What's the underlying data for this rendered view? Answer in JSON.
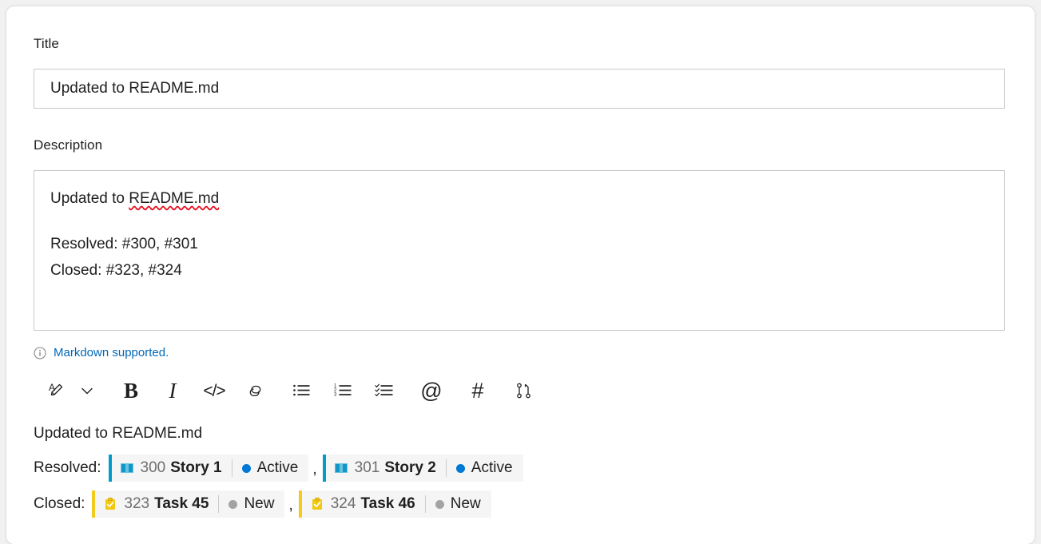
{
  "form": {
    "title_label": "Title",
    "title_value": "Updated to README.md",
    "description_label": "Description",
    "description_lines": [
      "Updated to README.md",
      "",
      "Resolved: #300, #301",
      "Closed: #323, #324"
    ],
    "description_misspelled_word": "README.md",
    "description_line1_prefix": "Updated to ",
    "markdown_note": "Markdown supported.",
    "markdown_note_icon": "info-circle-icon"
  },
  "toolbar": {
    "buttons": [
      {
        "name": "font-style-icon",
        "label": "A"
      },
      {
        "name": "chevron-down-icon",
        "label": ""
      },
      {
        "name": "bold-icon",
        "label": "B"
      },
      {
        "name": "italic-icon",
        "label": "I"
      },
      {
        "name": "code-icon",
        "label": "</>"
      },
      {
        "name": "link-icon",
        "label": ""
      },
      {
        "name": "bulleted-list-icon",
        "label": ""
      },
      {
        "name": "numbered-list-icon",
        "label": ""
      },
      {
        "name": "checklist-icon",
        "label": ""
      },
      {
        "name": "mention-icon",
        "label": "@"
      },
      {
        "name": "hashtag-icon",
        "label": "#"
      },
      {
        "name": "pull-request-icon",
        "label": ""
      }
    ]
  },
  "preview": {
    "heading": "Updated to README.md",
    "rows": [
      {
        "label": "Resolved:",
        "separator": ",",
        "items": [
          {
            "id": "300",
            "title": "Story 1",
            "state": "Active",
            "icon": "story-book-icon",
            "accent_color": "#009CCC",
            "state_color": "#0078D4"
          },
          {
            "id": "301",
            "title": "Story 2",
            "state": "Active",
            "icon": "story-book-icon",
            "accent_color": "#009CCC",
            "state_color": "#0078D4"
          }
        ]
      },
      {
        "label": "Closed:",
        "separator": ",",
        "items": [
          {
            "id": "323",
            "title": "Task 45",
            "state": "New",
            "icon": "task-clipboard-icon",
            "accent_color": "#F2CB1D",
            "state_color": "#A3A3A3"
          },
          {
            "id": "324",
            "title": "Task 46",
            "state": "New",
            "icon": "task-clipboard-icon",
            "accent_color": "#F2CB1D",
            "state_color": "#A3A3A3"
          }
        ]
      }
    ]
  },
  "colors": {
    "link_blue": "#0067b8",
    "text": "#1f1f1f",
    "border": "#c8c8c8",
    "chip_bg": "#f5f5f5",
    "spellcheck_red": "#e81123"
  }
}
